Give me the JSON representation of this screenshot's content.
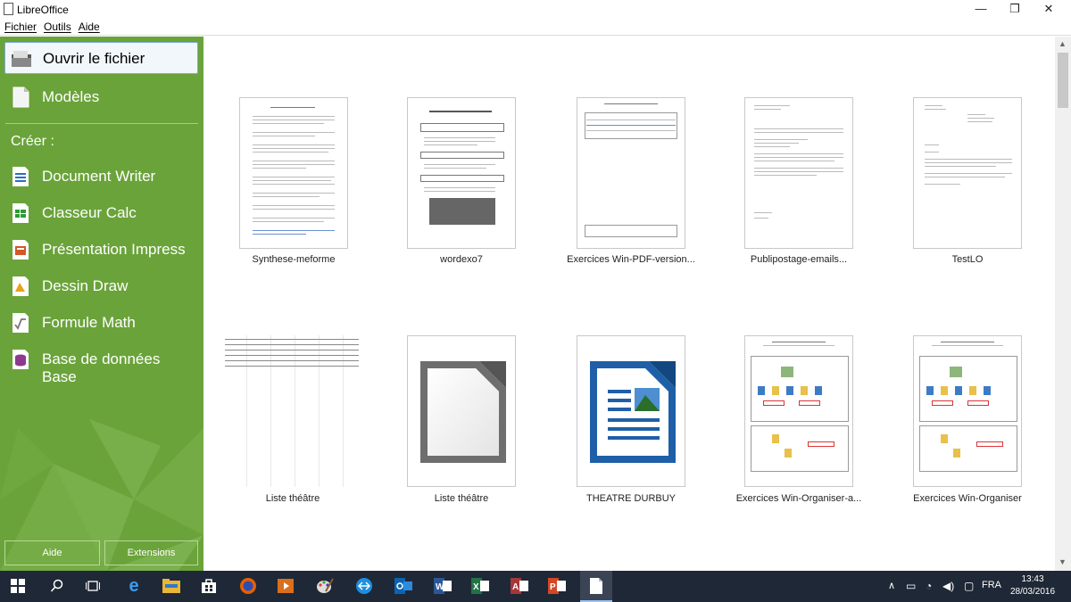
{
  "window": {
    "title": "LibreOffice",
    "minimize": "—",
    "maximize": "❐",
    "close": "✕"
  },
  "menu": [
    "Fichier",
    "Outils",
    "Aide"
  ],
  "sidebar": {
    "open_label": "Ouvrir le fichier",
    "templates_label": "Modèles",
    "create_label": "Créer :",
    "items": [
      {
        "label": "Document Writer",
        "icon": "writer-icon",
        "color": "#2a6fbf"
      },
      {
        "label": "Classeur Calc",
        "icon": "calc-icon",
        "color": "#2d9b33"
      },
      {
        "label": "Présentation Impress",
        "icon": "impress-icon",
        "color": "#d4572a"
      },
      {
        "label": "Dessin Draw",
        "icon": "draw-icon",
        "color": "#e5a21b"
      },
      {
        "label": "Formule Math",
        "icon": "math-icon",
        "color": "#777777"
      },
      {
        "label": "Base de données Base",
        "icon": "base-icon",
        "color": "#8b3a8f"
      }
    ],
    "help_label": "Aide",
    "extensions_label": "Extensions",
    "bg_color": "#6aa33a"
  },
  "recent_docs": [
    {
      "title": "Synthese-meforme",
      "type": "text"
    },
    {
      "title": "wordexo7",
      "type": "text"
    },
    {
      "title": "Exercices Win-PDF-version...",
      "type": "table"
    },
    {
      "title": "Publipostage-emails...",
      "type": "letter"
    },
    {
      "title": "TestLO",
      "type": "letter"
    },
    {
      "title": "Liste théâtre",
      "type": "sheet"
    },
    {
      "title": "Liste théâtre",
      "type": "generic-icon"
    },
    {
      "title": "THEATRE DURBUY",
      "type": "writer-icon"
    },
    {
      "title": "Exercices Win-Organiser-a...",
      "type": "diagram"
    },
    {
      "title": "Exercices Win-Organiser",
      "type": "diagram"
    }
  ],
  "taskbar": {
    "lang": "FRA",
    "time": "13:43",
    "date": "28/03/2016"
  }
}
